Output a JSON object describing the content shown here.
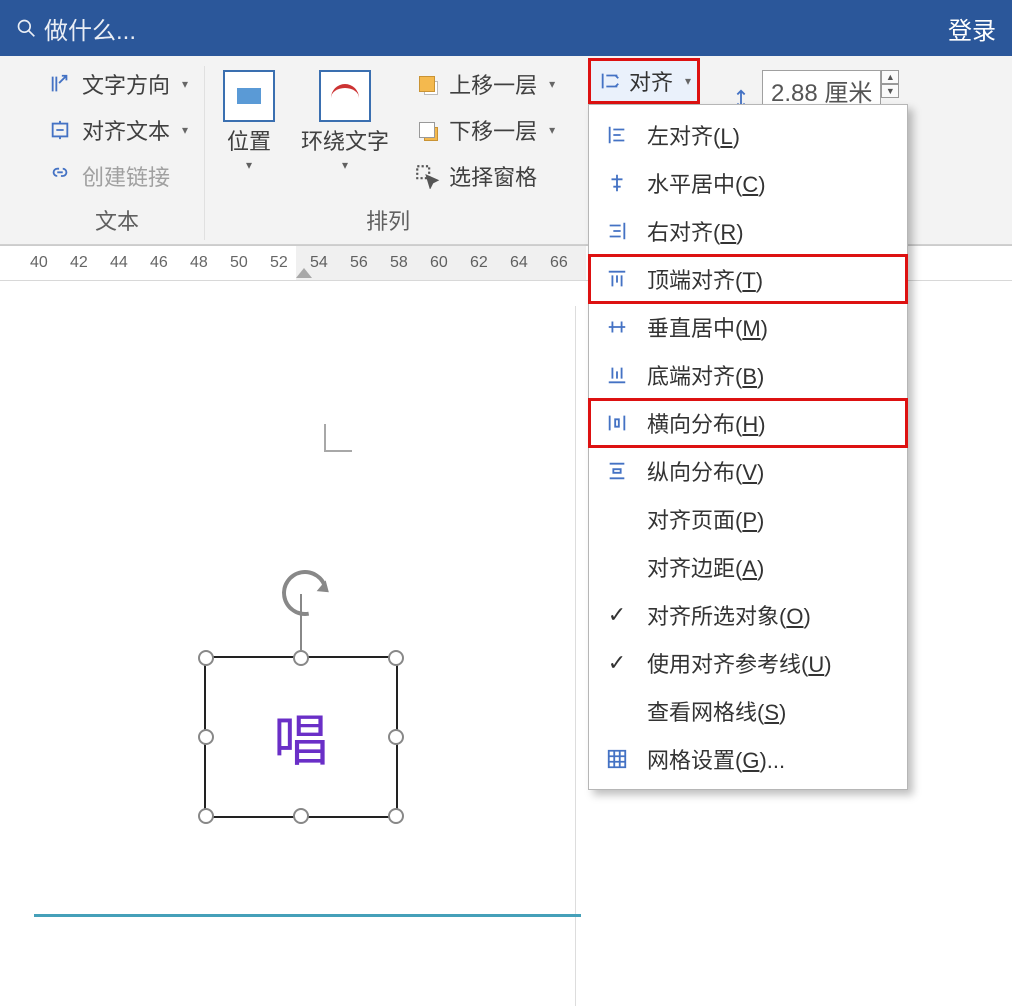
{
  "titlebar": {
    "search_placeholder": "做什么...",
    "login": "登录"
  },
  "ribbon": {
    "text_group_label": "文本",
    "arrange_group_label": "排列",
    "text_direction": "文字方向",
    "align_text": "对齐文本",
    "create_link": "创建链接",
    "position": "位置",
    "wrap_text": "环绕文字",
    "bring_forward": "上移一层",
    "send_backward": "下移一层",
    "selection_pane": "选择窗格",
    "align_btn": "对齐"
  },
  "size": {
    "height_value": "2.88 厘米"
  },
  "align_menu": {
    "left": {
      "label": "左对齐",
      "accel": "L"
    },
    "center": {
      "label": "水平居中",
      "accel": "C"
    },
    "right": {
      "label": "右对齐",
      "accel": "R"
    },
    "top": {
      "label": "顶端对齐",
      "accel": "T"
    },
    "middle": {
      "label": "垂直居中",
      "accel": "M"
    },
    "bottom": {
      "label": "底端对齐",
      "accel": "B"
    },
    "dist_h": {
      "label": "横向分布",
      "accel": "H"
    },
    "dist_v": {
      "label": "纵向分布",
      "accel": "V"
    },
    "to_page": {
      "label": "对齐页面",
      "accel": "P"
    },
    "to_margin": {
      "label": "对齐边距",
      "accel": "A"
    },
    "to_selected": {
      "label": "对齐所选对象",
      "accel": "O"
    },
    "use_guides": {
      "label": "使用对齐参考线",
      "accel": "U"
    },
    "view_grid": {
      "label": "查看网格线",
      "accel": "S"
    },
    "grid_settings": {
      "label": "网格设置",
      "accel": "G",
      "suffix": "..."
    }
  },
  "ruler": {
    "ticks": [
      "40",
      "42",
      "44",
      "46",
      "48",
      "50",
      "52",
      "54",
      "56",
      "58",
      "60",
      "62",
      "64",
      "66"
    ]
  },
  "textbox": {
    "content": "唱"
  }
}
